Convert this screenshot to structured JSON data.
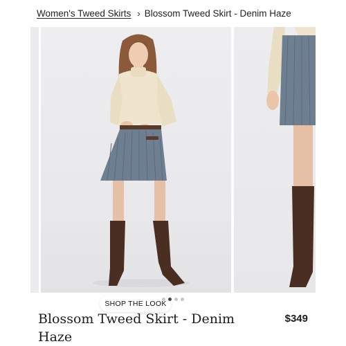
{
  "breadcrumb": {
    "parent_label": "Women's Tweed Skirts",
    "separator": "›",
    "current_label": "Blossom Tweed Skirt - Denim Haze"
  },
  "gallery": {
    "shop_the_look_label": "SHOP THE LOOK",
    "dot_count": 4,
    "active_dot": 2
  },
  "product": {
    "title": "Blossom Tweed Skirt - Denim Haze",
    "price": "$349"
  },
  "colors": {
    "skirt": "#6f7f92",
    "sweater": "#efe4cc",
    "boots": "#4a2e22"
  }
}
